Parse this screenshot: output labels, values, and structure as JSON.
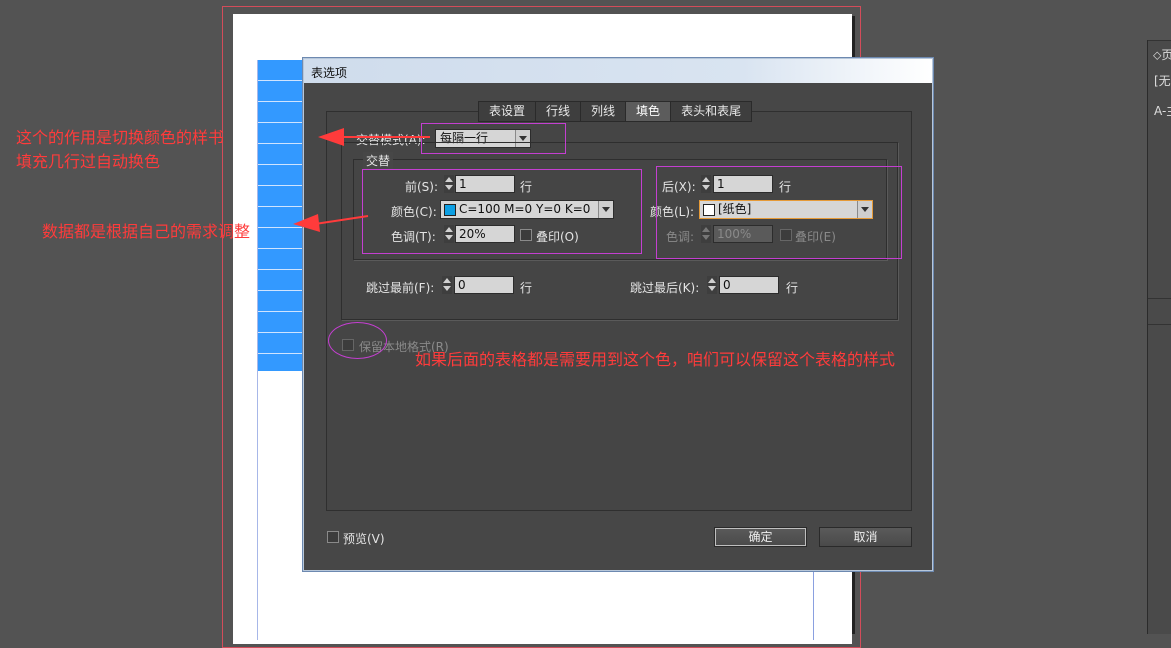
{
  "dialog": {
    "title": "表选项",
    "tabs": [
      {
        "label": "表设置",
        "active": false
      },
      {
        "label": "行线",
        "active": false
      },
      {
        "label": "列线",
        "active": false
      },
      {
        "label": "填色",
        "active": true
      },
      {
        "label": "表头和表尾",
        "active": false
      }
    ],
    "alternate_pattern": {
      "label": "交替模式(A):",
      "value": "每隔一行"
    },
    "alternating_group": "交替",
    "first": {
      "label": "前(S):",
      "value": "1",
      "unit": "行",
      "color_label": "颜色(C):",
      "color_value": "C=100 M=0 Y=0 K=0",
      "color_swatch": "#0c9fe3",
      "tint_label": "色调(T):",
      "tint_value": "20%",
      "overprint_label": "叠印(O)"
    },
    "next": {
      "label": "后(X):",
      "value": "1",
      "unit": "行",
      "color_label": "颜色(L):",
      "color_value": "[纸色]",
      "color_swatch": "#ffffff",
      "tint_label": "色调:",
      "tint_value": "100%",
      "overprint_label": "叠印(E)"
    },
    "skip_first": {
      "label": "跳过最前(F):",
      "value": "0",
      "unit": "行"
    },
    "skip_last": {
      "label": "跳过最后(K):",
      "value": "0",
      "unit": "行"
    },
    "preserve_local": "保留本地格式(R)",
    "preview": "预览(V)",
    "ok": "确定",
    "cancel": "取消"
  },
  "right_panel": {
    "item1": "⬦页",
    "item2": "[无",
    "item3": "A-主"
  },
  "annotations": {
    "a1_line1": "这个的作用是切换颜色的样书",
    "a1_line2": "填充几行过自动换色",
    "a2": "数据都是根据自己的需求调整",
    "a3": "如果后面的表格都是需要用到这个色，咱们可以保留这个表格的样式"
  },
  "colors": {
    "annotation": "#ff3b3b",
    "highlight_box": "#c43fd1",
    "table_fill": "#3399ff"
  }
}
